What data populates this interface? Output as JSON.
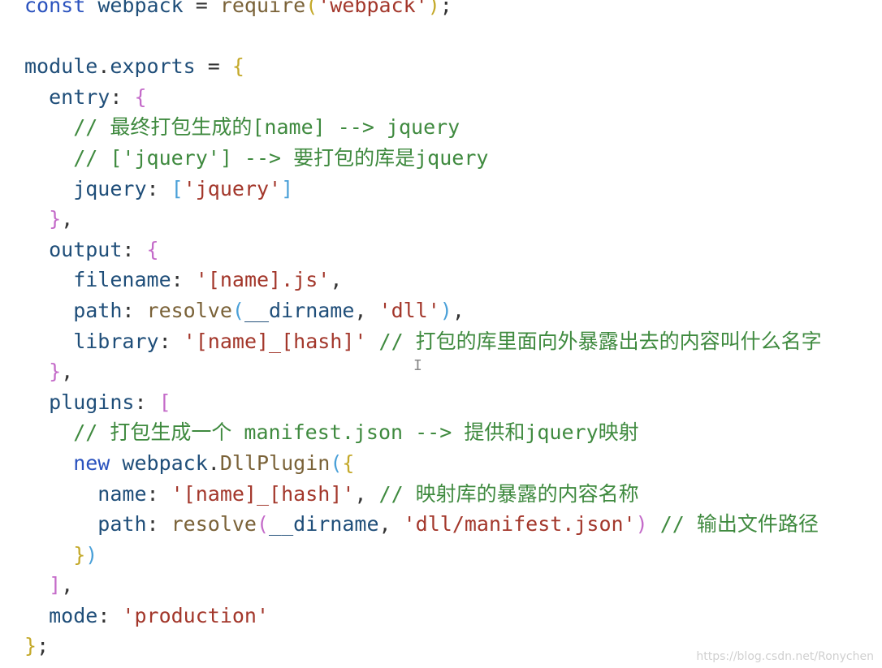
{
  "editor": {
    "lines": [
      [
        {
          "t": "const ",
          "c": "kw"
        },
        {
          "t": "webpack",
          "c": "var"
        },
        {
          "t": " = ",
          "c": "punc"
        },
        {
          "t": "require",
          "c": "fn"
        },
        {
          "t": "(",
          "c": "paren"
        },
        {
          "t": "'webpack'",
          "c": "str"
        },
        {
          "t": ")",
          "c": "paren"
        },
        {
          "t": ";",
          "c": "punc"
        }
      ],
      [],
      [
        {
          "t": "module",
          "c": "var"
        },
        {
          "t": ".",
          "c": "punc"
        },
        {
          "t": "exports",
          "c": "var"
        },
        {
          "t": " = ",
          "c": "punc"
        },
        {
          "t": "{",
          "c": "paren"
        }
      ],
      [
        {
          "t": "  entry",
          "c": "prop"
        },
        {
          "t": ": ",
          "c": "punc"
        },
        {
          "t": "{",
          "c": "brace"
        }
      ],
      [
        {
          "t": "    // 最终打包生成的[name] --> jquery",
          "c": "cmt"
        }
      ],
      [
        {
          "t": "    // ['jquery'] --> 要打包的库是jquery",
          "c": "cmt"
        }
      ],
      [
        {
          "t": "    jquery",
          "c": "prop"
        },
        {
          "t": ": ",
          "c": "punc"
        },
        {
          "t": "[",
          "c": "bracket"
        },
        {
          "t": "'jquery'",
          "c": "str"
        },
        {
          "t": "]",
          "c": "bracket"
        }
      ],
      [
        {
          "t": "  ",
          "c": "punc"
        },
        {
          "t": "}",
          "c": "brace"
        },
        {
          "t": ",",
          "c": "punc"
        }
      ],
      [
        {
          "t": "  output",
          "c": "prop"
        },
        {
          "t": ": ",
          "c": "punc"
        },
        {
          "t": "{",
          "c": "brace"
        }
      ],
      [
        {
          "t": "    filename",
          "c": "prop"
        },
        {
          "t": ": ",
          "c": "punc"
        },
        {
          "t": "'[name].js'",
          "c": "str"
        },
        {
          "t": ",",
          "c": "punc"
        }
      ],
      [
        {
          "t": "    path",
          "c": "prop"
        },
        {
          "t": ": ",
          "c": "punc"
        },
        {
          "t": "resolve",
          "c": "fn"
        },
        {
          "t": "(",
          "c": "bracket"
        },
        {
          "t": "__dirname",
          "c": "var"
        },
        {
          "t": ", ",
          "c": "punc"
        },
        {
          "t": "'dll'",
          "c": "str"
        },
        {
          "t": ")",
          "c": "bracket"
        },
        {
          "t": ",",
          "c": "punc"
        }
      ],
      [
        {
          "t": "    library",
          "c": "prop"
        },
        {
          "t": ": ",
          "c": "punc"
        },
        {
          "t": "'[name]_[hash]'",
          "c": "str"
        },
        {
          "t": " // 打包的库里面向外暴露出去的内容叫什么名字",
          "c": "cmt"
        }
      ],
      [
        {
          "t": "  ",
          "c": "punc"
        },
        {
          "t": "}",
          "c": "brace"
        },
        {
          "t": ",",
          "c": "punc"
        }
      ],
      [
        {
          "t": "  plugins",
          "c": "prop"
        },
        {
          "t": ": ",
          "c": "punc"
        },
        {
          "t": "[",
          "c": "brace"
        }
      ],
      [
        {
          "t": "    // 打包生成一个 manifest.json --> 提供和jquery映射",
          "c": "cmt"
        }
      ],
      [
        {
          "t": "    new ",
          "c": "kw"
        },
        {
          "t": "webpack",
          "c": "var"
        },
        {
          "t": ".",
          "c": "punc"
        },
        {
          "t": "DllPlugin",
          "c": "fn"
        },
        {
          "t": "(",
          "c": "bracket"
        },
        {
          "t": "{",
          "c": "paren"
        }
      ],
      [
        {
          "t": "      name",
          "c": "prop"
        },
        {
          "t": ": ",
          "c": "punc"
        },
        {
          "t": "'[name]_[hash]'",
          "c": "str"
        },
        {
          "t": ", ",
          "c": "punc"
        },
        {
          "t": "// 映射库的暴露的内容名称",
          "c": "cmt"
        }
      ],
      [
        {
          "t": "      path",
          "c": "prop"
        },
        {
          "t": ": ",
          "c": "punc"
        },
        {
          "t": "resolve",
          "c": "fn"
        },
        {
          "t": "(",
          "c": "brace"
        },
        {
          "t": "__dirname",
          "c": "var"
        },
        {
          "t": ", ",
          "c": "punc"
        },
        {
          "t": "'dll/manifest.json'",
          "c": "str"
        },
        {
          "t": ")",
          "c": "brace"
        },
        {
          "t": " // 输出文件路径",
          "c": "cmt"
        }
      ],
      [
        {
          "t": "    ",
          "c": "punc"
        },
        {
          "t": "}",
          "c": "paren"
        },
        {
          "t": ")",
          "c": "bracket"
        }
      ],
      [
        {
          "t": "  ",
          "c": "punc"
        },
        {
          "t": "]",
          "c": "brace"
        },
        {
          "t": ",",
          "c": "punc"
        }
      ],
      [
        {
          "t": "  mode",
          "c": "prop"
        },
        {
          "t": ": ",
          "c": "punc"
        },
        {
          "t": "'production'",
          "c": "str"
        }
      ],
      [
        {
          "t": "}",
          "c": "paren"
        },
        {
          "t": ";",
          "c": "punc"
        }
      ]
    ]
  },
  "watermark": "https://blog.csdn.net/Ronychen",
  "cursor_glyph": "I"
}
